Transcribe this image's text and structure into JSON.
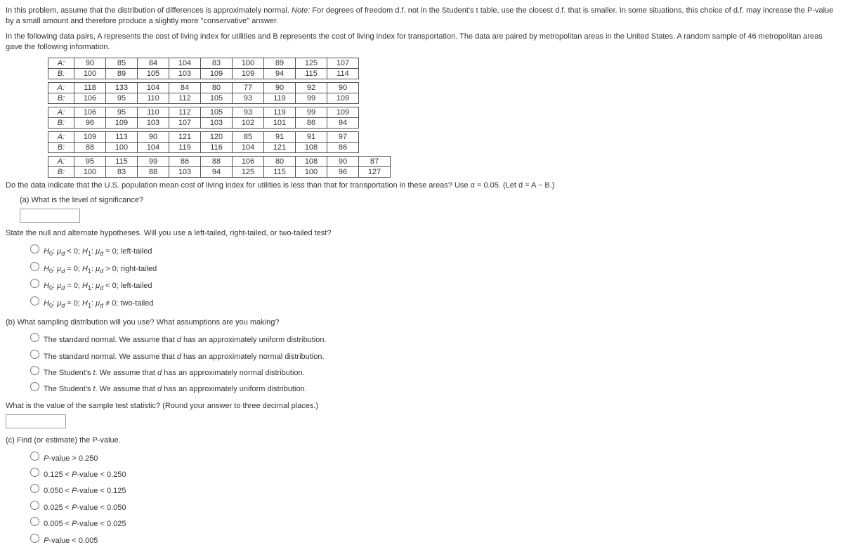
{
  "intro1": "In this problem, assume that the distribution of differences is approximately normal. ",
  "intro_note_label": "Note:",
  "intro1b": " For degrees of freedom d.f. not in the Student's t table, use the closest d.f. that is smaller. In some situations, this choice of d.f. may increase the P-value by a small amount and therefore produce a slightly more \"conservative\" answer.",
  "intro2": "In the following data pairs, A represents the cost of living index for utilities and B represents the cost of living index for transportation. The data are paired by metropolitan areas in the United States. A random sample of 46 metropolitan areas gave the following information.",
  "tables": [
    {
      "A": [
        "90",
        "85",
        "84",
        "104",
        "83",
        "100",
        "89",
        "125",
        "107"
      ],
      "B": [
        "100",
        "89",
        "105",
        "103",
        "109",
        "109",
        "94",
        "115",
        "114"
      ]
    },
    {
      "A": [
        "118",
        "133",
        "104",
        "84",
        "80",
        "77",
        "90",
        "92",
        "90"
      ],
      "B": [
        "106",
        "95",
        "110",
        "112",
        "105",
        "93",
        "119",
        "99",
        "109"
      ]
    },
    {
      "A": [
        "106",
        "95",
        "110",
        "112",
        "105",
        "93",
        "119",
        "99",
        "109"
      ],
      "B": [
        "96",
        "109",
        "103",
        "107",
        "103",
        "102",
        "101",
        "86",
        "94"
      ]
    },
    {
      "A": [
        "109",
        "113",
        "90",
        "121",
        "120",
        "85",
        "91",
        "91",
        "97"
      ],
      "B": [
        "88",
        "100",
        "104",
        "119",
        "116",
        "104",
        "121",
        "108",
        "86"
      ]
    },
    {
      "A": [
        "95",
        "115",
        "99",
        "86",
        "88",
        "106",
        "80",
        "108",
        "90",
        "87"
      ],
      "B": [
        "100",
        "83",
        "88",
        "103",
        "94",
        "125",
        "115",
        "100",
        "96",
        "127"
      ]
    }
  ],
  "q_main": "Do the data indicate that the U.S. population mean cost of living index for utilities is less than that for transportation in these areas? Use α = 0.05. (Let d = A − B.)",
  "q_a": "(a) What is the level of significance?",
  "state_hyp": "State the null and alternate hypotheses. Will you use a left-tailed, right-tailed, or two-tailed test?",
  "hyp_opts": [
    "H₀: μ_d < 0; H₁: μ_d = 0; left-tailed",
    "H₀: μ_d = 0; H₁: μ_d > 0; right-tailed",
    "H₀: μ_d = 0; H₁: μ_d < 0; left-tailed",
    "H₀: μ_d = 0; H₁: μ_d ≠ 0; two-tailed"
  ],
  "q_b": "(b) What sampling distribution will you use? What assumptions are you making?",
  "dist_opts": [
    "The standard normal. We assume that d has an approximately uniform distribution.",
    "The standard normal. We assume that d has an approximately normal distribution.",
    "The Student's t. We assume that d has an approximately normal distribution.",
    "The Student's t. We assume that d has an approximately uniform distribution."
  ],
  "test_stat_q": "What is the value of the sample test statistic? (Round your answer to three decimal places.)",
  "q_c": "(c) Find (or estimate) the P-value.",
  "pval_opts": [
    "P-value > 0.250",
    "0.125 < P-value < 0.250",
    "0.050 < P-value < 0.125",
    "0.025 < P-value < 0.050",
    "0.005 < P-value < 0.025",
    "P-value < 0.005"
  ],
  "labels": {
    "A": "A:",
    "B": "B:"
  }
}
